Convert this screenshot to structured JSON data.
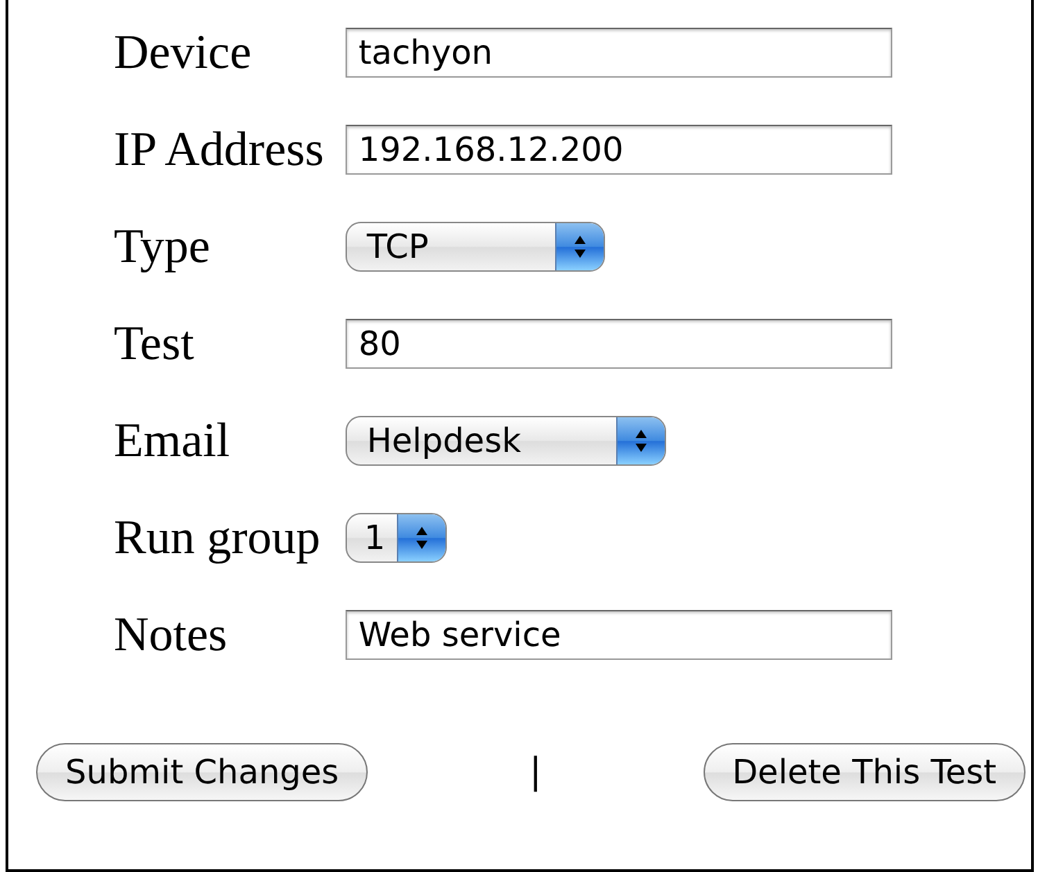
{
  "fields": [
    {
      "label": "Device",
      "kind": "text",
      "value": "tachyon"
    },
    {
      "label": "IP Address",
      "kind": "text",
      "value": "192.168.12.200"
    },
    {
      "label": "Type",
      "kind": "select",
      "value": "TCP"
    },
    {
      "label": "Test",
      "kind": "text",
      "value": "80"
    },
    {
      "label": "Email",
      "kind": "select",
      "value": "Helpdesk"
    },
    {
      "label": "Run group",
      "kind": "select",
      "value": "1"
    },
    {
      "label": "Notes",
      "kind": "text",
      "value": "Web service"
    }
  ],
  "separator": "|",
  "buttons": [
    "Submit Changes",
    "Delete This Test"
  ]
}
